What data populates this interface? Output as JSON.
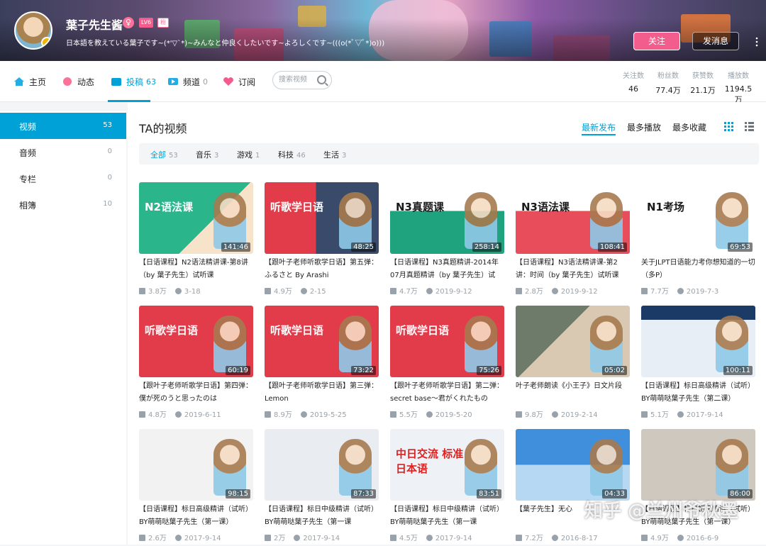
{
  "header": {
    "username": "葉子先生酱",
    "gender_icon": "female-icon",
    "gender_glyph": "♀",
    "level": "LV6",
    "fan_badge": "粉",
    "sign": "日本語を教えている葉子です~(*'▽`*)~みんなと仲良くしたいです~よろしくです~(((o(*ﾟ▽ﾟ*)o)))",
    "follow_label": "关注",
    "message_label": "发消息"
  },
  "nav": {
    "items": [
      {
        "label": "主页",
        "count": "",
        "icon": "home-icon",
        "color": "#23ade5"
      },
      {
        "label": "动态",
        "count": "",
        "icon": "dynamic-icon",
        "color": "#fb7299"
      },
      {
        "label": "投稿",
        "count": "63",
        "icon": "upload-icon",
        "color": "#00a1d6"
      },
      {
        "label": "频道",
        "count": "0",
        "icon": "channel-icon",
        "color": "#23ade5"
      },
      {
        "label": "订阅",
        "count": "",
        "icon": "heart-icon",
        "color": "#f45a8d"
      }
    ],
    "search_placeholder": "搜索视频"
  },
  "stats": [
    {
      "label": "关注数",
      "value": "46"
    },
    {
      "label": "粉丝数",
      "value": "77.4万"
    },
    {
      "label": "获赞数",
      "value": "21.1万"
    },
    {
      "label": "播放数",
      "value": "1194.5万"
    }
  ],
  "sidebar": {
    "items": [
      {
        "label": "视频",
        "count": "53"
      },
      {
        "label": "音频",
        "count": "0"
      },
      {
        "label": "专栏",
        "count": "0"
      },
      {
        "label": "相簿",
        "count": "10"
      }
    ]
  },
  "main": {
    "title": "TA的视频",
    "sorts": [
      "最新发布",
      "最多播放",
      "最多收藏"
    ],
    "filters": [
      {
        "label": "全部",
        "count": "53"
      },
      {
        "label": "音乐",
        "count": "3"
      },
      {
        "label": "游戏",
        "count": "1"
      },
      {
        "label": "科技",
        "count": "46"
      },
      {
        "label": "生活",
        "count": "3"
      }
    ]
  },
  "videos": [
    {
      "title": "【日语课程】N2语法精讲课-第8讲（by 葉子先生）试听课",
      "duration": "141:46",
      "plays": "3.8万",
      "date": "3-18",
      "thumb_text": "N2语法课"
    },
    {
      "title": "【跟叶子老师听歌学日语】第五弹：ふるさと By Arashi",
      "duration": "48:25",
      "plays": "4.9万",
      "date": "2-15",
      "thumb_text": "听歌学日语"
    },
    {
      "title": "【日语课程】N3真题精讲-2014年07月真题精讲（by 葉子先生）试",
      "duration": "258:14",
      "plays": "4.7万",
      "date": "2019-9-12",
      "thumb_text": "N3真题课"
    },
    {
      "title": "【日语课程】N3语法精讲课-第2讲：时间（by 葉子先生）试听课",
      "duration": "108:41",
      "plays": "2.8万",
      "date": "2019-9-12",
      "thumb_text": "N3语法课"
    },
    {
      "title": "关于JLPT日语能力考你想知道的一切（多P）",
      "duration": "69:53",
      "plays": "7.7万",
      "date": "2019-7-3",
      "thumb_text": "N1考场"
    },
    {
      "title": "【跟叶子老师听歌学日语】第四弹：僕が死のうと思ったのは",
      "duration": "60:19",
      "plays": "4.8万",
      "date": "2019-6-11",
      "thumb_text": "听歌学日语"
    },
    {
      "title": "【跟叶子老师听歌学日语】第三弹：Lemon",
      "duration": "73:22",
      "plays": "8.9万",
      "date": "2019-5-25",
      "thumb_text": "听歌学日语"
    },
    {
      "title": "【跟叶子老师听歌学日语】第二弹：secret base～君がくれたもの",
      "duration": "75:26",
      "plays": "5.5万",
      "date": "2019-5-20",
      "thumb_text": "听歌学日语"
    },
    {
      "title": "叶子老师朗读《小王子》日文片段",
      "duration": "05:02",
      "plays": "9.8万",
      "date": "2019-2-14",
      "thumb_text": ""
    },
    {
      "title": "【日语课程】标日高级精讲（试听）BY萌萌哒葉子先生（第二课）",
      "duration": "100:11",
      "plays": "5.1万",
      "date": "2017-9-14",
      "thumb_text": ""
    },
    {
      "title": "【日语课程】标日高级精讲（试听）BY萌萌哒葉子先生（第一课）",
      "duration": "98:15",
      "plays": "2.6万",
      "date": "2017-9-14",
      "thumb_text": ""
    },
    {
      "title": "【日语课程】标日中级精讲（试听）BY萌萌哒葉子先生（第一课",
      "duration": "87:33",
      "plays": "2万",
      "date": "2017-9-14",
      "thumb_text": ""
    },
    {
      "title": "【日语课程】标日中级精讲（试听）BY萌萌哒葉子先生（第一课",
      "duration": "83:51",
      "plays": "4.5万",
      "date": "2017-9-14",
      "thumb_text": "中日交流 标准日本语"
    },
    {
      "title": "【葉子先生】无心",
      "duration": "04:33",
      "plays": "7.2万",
      "date": "2016-8-17",
      "thumb_text": ""
    },
    {
      "title": "【日语课程】标日初级精讲（试听）BY萌萌哒葉子先生（第一课）",
      "duration": "86:00",
      "plays": "4.9万",
      "date": "2016-6-9",
      "thumb_text": ""
    }
  ],
  "watermark": "知乎 @兰州爷秋墨"
}
